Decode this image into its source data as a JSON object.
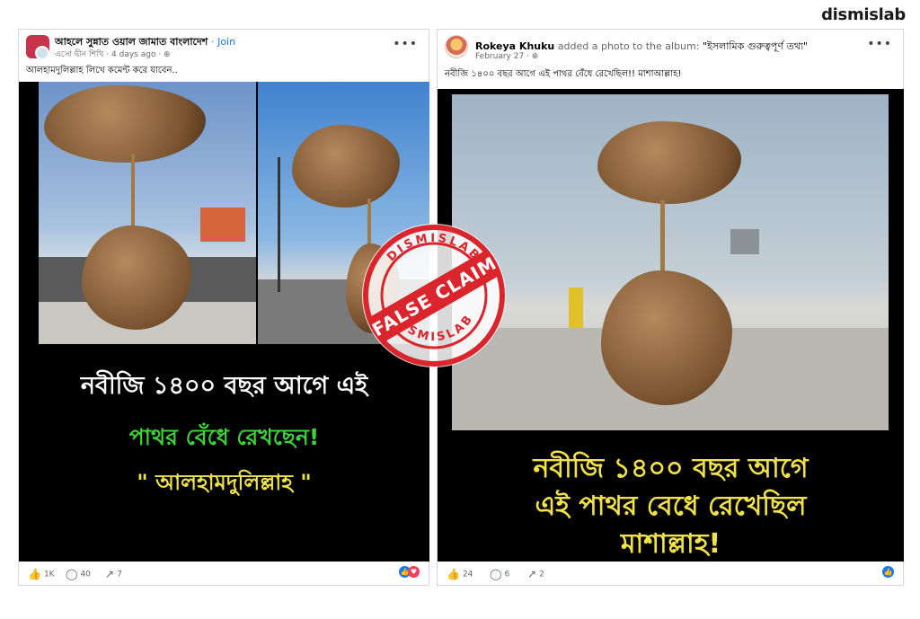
{
  "brand": "dismislab",
  "left_post": {
    "group_name": "আহলে সুন্নাত ওয়াল জামাত বাংলাদেশ",
    "join": "· Join",
    "author": "এসো দ্বীন শিখি",
    "time": "· 4 days ago ·",
    "caption": "আলহামদুলিল্লাহ লিখে কমেন্ট করে যাবেন..",
    "overlay_line1": "নবীজি ১৪০০ বছর আগে এই",
    "overlay_line2": "পাথর বেঁধে রেখছেন!",
    "overlay_line3": "\" আলহামদুলিল্লাহ \"",
    "likes": "1K",
    "comments": "40",
    "shares": "7"
  },
  "right_post": {
    "user": "Rokeya Khuku",
    "action": "added a photo to the album:",
    "album": "\"ইসলামিক গুরুত্বপূর্ণ তথ্য\"",
    "time": "February 27 ·",
    "caption": "নবীজি ১৪০০ বছর আগে এই পাথর বেঁধে রেখেছিল!! মাশাআল্লাহ!",
    "overlay_line1": "নবীজি ১৪০০ বছর আগে",
    "overlay_line2": "এই পাথর বেধে রেখেছিল",
    "overlay_line3": "মাশাল্লাহ!",
    "likes": "24",
    "comments": "6",
    "shares": "2"
  },
  "stamp": {
    "label": "FALSE CLAIM",
    "ring_text": "DISMISLAB"
  },
  "colors": {
    "stamp_red": "#d9252b",
    "overlay_white": "#ffffff",
    "overlay_green": "#3fd23a",
    "overlay_yellow": "#f2e24a",
    "fb_blue": "#1877f2"
  }
}
